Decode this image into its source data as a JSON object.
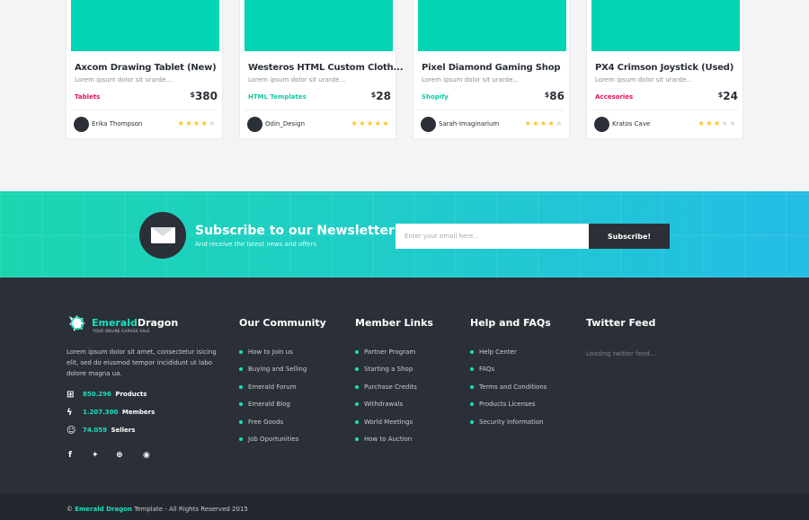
{
  "products": [
    {
      "title": "Axcom Drawing Tablet (New)",
      "desc": "Lorem ipsum dolor sit urarde...",
      "category": "Tablets",
      "category_color": "#e8115a",
      "currency": "$",
      "price": "380",
      "author": "Erika Thompson",
      "rating": 4,
      "rating_max": 5
    },
    {
      "title": "Westeros HTML Custom Cloth...",
      "desc": "Lorem ipsum dolor sit urarde...",
      "category": "HTML Templates",
      "category_color": "#10c9a6",
      "currency": "$",
      "price": "28",
      "author": "Odin_Design",
      "rating": 5,
      "rating_max": 5
    },
    {
      "title": "Pixel Diamond Gaming Shop",
      "desc": "Lorem ipsum dolor sit urarde...",
      "category": "Shopify",
      "category_color": "#10c9a6",
      "currency": "$",
      "price": "86",
      "author": "Sarah-Imaginarium",
      "rating": 4,
      "rating_max": 5
    },
    {
      "title": "PX4 Crimson Joystick (Used)",
      "desc": "Lorem ipsum dolor sit urarde...",
      "category": "Accesories",
      "category_color": "#e8115a",
      "currency": "$",
      "price": "24",
      "author": "Kratos Cave",
      "rating": 3,
      "rating_max": 5
    }
  ],
  "newsletter": {
    "title": "Subscribe to our Newsletter",
    "subtitle": "And receive the latest news and offers",
    "email_placeholder": "Enter your email here...",
    "button_label": "Subscribe!",
    "icon": "envelope-icon"
  },
  "footer": {
    "logo": {
      "part1": "Emerald",
      "part2": "Dragon",
      "tagline": "YOUR ONLINE GARAGE SALE"
    },
    "about": "Lorem ipsum dolor sit amet, consectetur isicing elit, sed do eiusmod tempor incididunt ut labo dolore magna ua.",
    "stats": [
      {
        "icon": "gift-icon",
        "value": "850.296",
        "label": "Products"
      },
      {
        "icon": "lightning-icon",
        "value": "1.207.300",
        "label": "Members"
      },
      {
        "icon": "user-icon",
        "value": "74.059",
        "label": "Sellers"
      }
    ],
    "social": [
      "facebook-icon",
      "twitter-icon",
      "dribbble-icon",
      "rss-icon"
    ],
    "columns": [
      {
        "title": "Our Community",
        "links": [
          "How to Join us",
          "Buying and Selling",
          "Emerald Forum",
          "Emerald Blog",
          "Free Goods",
          "Job Oportunities"
        ]
      },
      {
        "title": "Member Links",
        "links": [
          "Partner Program",
          "Starting a Shop",
          "Purchase Credits",
          "Withdrawals",
          "World Meetings",
          "How to Auction"
        ]
      },
      {
        "title": "Help and FAQs",
        "links": [
          "Help Center",
          "FAQs",
          "Terms and Conditions",
          "Products Licenses",
          "Security Information"
        ]
      }
    ],
    "twitter": {
      "title": "Twitter Feed",
      "loading": "Loading twitter feed..."
    }
  },
  "copyright": {
    "symbol": "©",
    "brand": "Emerald Dragon",
    "rest": "Template - All Rights Reserved 2015"
  },
  "colors": {
    "accent": "#16e2c0",
    "dark": "#2b3038",
    "card_thumb": "#00d4b4"
  }
}
